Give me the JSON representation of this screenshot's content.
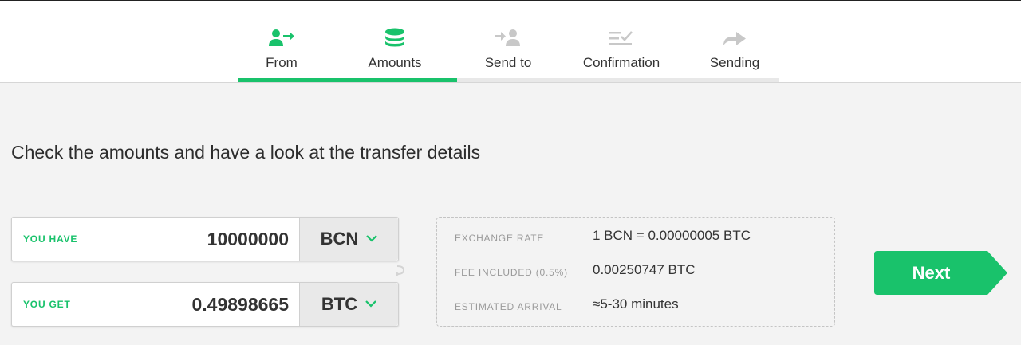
{
  "steps": [
    {
      "label": "From",
      "icon": "user-arrow-icon",
      "active": true
    },
    {
      "label": "Amounts",
      "icon": "coins-stack-icon",
      "active": true
    },
    {
      "label": "Send to",
      "icon": "arrow-user-icon",
      "active": false
    },
    {
      "label": "Confirmation",
      "icon": "checklist-icon",
      "active": false
    },
    {
      "label": "Sending",
      "icon": "forward-arrow-icon",
      "active": false
    }
  ],
  "progress": {
    "completed_fraction": 0.405
  },
  "heading": "Check the amounts and have a look at the transfer details",
  "have": {
    "label": "YOU HAVE",
    "value": "10000000",
    "currency": "BCN"
  },
  "get": {
    "label": "YOU GET",
    "value": "0.49898665",
    "currency": "BTC"
  },
  "details": {
    "exchange_rate": {
      "label": "EXCHANGE RATE",
      "value": "1 BCN = 0.00000005 BTC"
    },
    "fee": {
      "label": "FEE INCLUDED (0.5%)",
      "value": "0.00250747 BTC"
    },
    "arrival": {
      "label": "ESTIMATED ARRIVAL",
      "value": "≈5-30 minutes"
    }
  },
  "next_label": "Next",
  "colors": {
    "accent": "#19c26b",
    "inactive_icon": "#c8c8c8",
    "background": "#f3f3f3"
  }
}
